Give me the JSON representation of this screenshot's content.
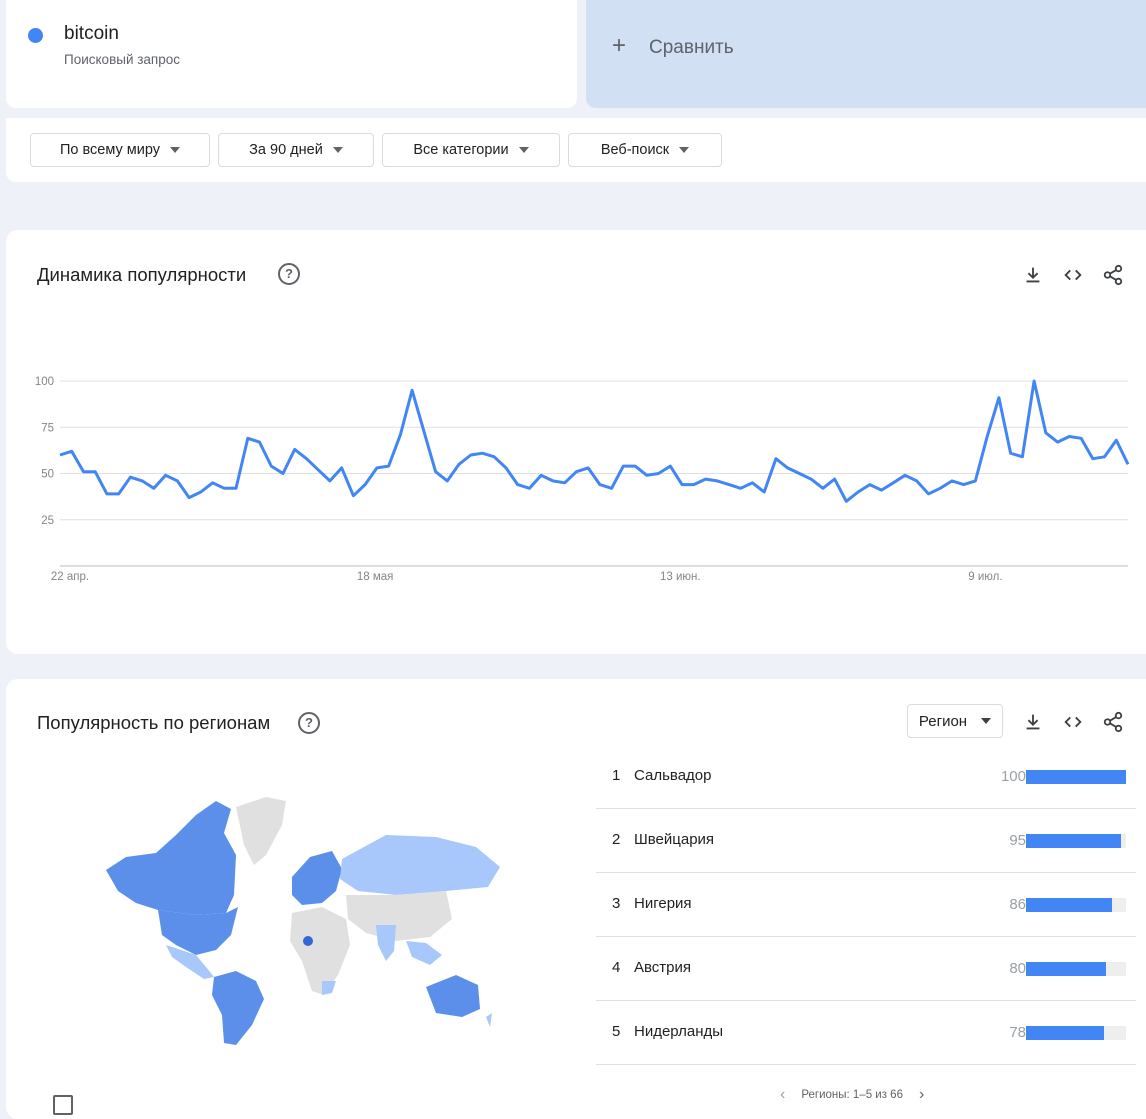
{
  "term": {
    "name": "bitcoin",
    "subtitle": "Поисковый запрос",
    "color": "#4285f4"
  },
  "compare": {
    "label": "Сравнить",
    "icon": "plus-icon"
  },
  "filters": [
    {
      "label": "По всему миру"
    },
    {
      "label": "За 90 дней"
    },
    {
      "label": "Все категории"
    },
    {
      "label": "Веб-поиск"
    }
  ],
  "interest_over_time": {
    "title": "Динамика популярности",
    "help_icon": "help-circle-icon",
    "actions": [
      "download-icon",
      "embed-code-icon",
      "share-icon"
    ]
  },
  "chart_data": {
    "type": "line",
    "title": "",
    "xlabel": "",
    "ylabel": "",
    "ylim": [
      0,
      100
    ],
    "yticks": [
      25,
      50,
      75,
      100
    ],
    "x_tick_labels": [
      "22 апр.",
      "18 мая",
      "13 июн.",
      "9 июл."
    ],
    "x_tick_indices": [
      0,
      26,
      52,
      78
    ],
    "grid": true,
    "series": [
      {
        "color": "#4285f4",
        "values": [
          60,
          62,
          51,
          51,
          39,
          39,
          48,
          46,
          42,
          49,
          46,
          37,
          40,
          45,
          42,
          42,
          69,
          67,
          54,
          50,
          63,
          58,
          52,
          46,
          53,
          38,
          44,
          53,
          54,
          71,
          95,
          73,
          51,
          46,
          55,
          60,
          61,
          59,
          53,
          44,
          42,
          49,
          46,
          45,
          51,
          53,
          44,
          42,
          54,
          54,
          49,
          50,
          54,
          44,
          44,
          47,
          46,
          44,
          42,
          45,
          40,
          58,
          53,
          50,
          47,
          42,
          47,
          35,
          40,
          44,
          41,
          45,
          49,
          46,
          39,
          42,
          46,
          44,
          46,
          70,
          91,
          61,
          59,
          100,
          72,
          67,
          70,
          69,
          58,
          59,
          68,
          55
        ]
      }
    ]
  },
  "interest_by_region": {
    "title": "Популярность по регионам",
    "help_icon": "help-circle-icon",
    "resolution": "Регион",
    "actions": [
      "download-icon",
      "embed-code-icon",
      "share-icon"
    ],
    "rows": [
      {
        "rank": "1",
        "name": "Сальвадор",
        "value": "100",
        "fill": 1.0
      },
      {
        "rank": "2",
        "name": "Швейцария",
        "value": "95",
        "fill": 0.95
      },
      {
        "rank": "3",
        "name": "Нигерия",
        "value": "86",
        "fill": 0.86
      },
      {
        "rank": "4",
        "name": "Австрия",
        "value": "80",
        "fill": 0.8
      },
      {
        "rank": "5",
        "name": "Нидерланды",
        "value": "78",
        "fill": 0.78
      }
    ],
    "pager": "Регионы: 1–5 из 66",
    "map_colors": {
      "high": "#3367d6",
      "mid": "#5b8fea",
      "low": "#a8c7fa",
      "none": "#e0e0e0"
    }
  }
}
